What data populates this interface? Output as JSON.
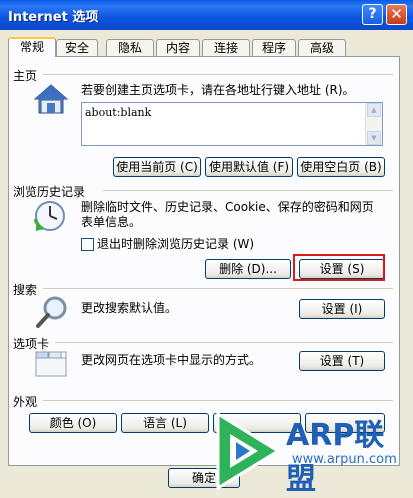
{
  "window": {
    "title": "Internet 选项",
    "help_glyph": "?",
    "close_glyph": "✕"
  },
  "tabs": [
    {
      "label": "常规",
      "active": true
    },
    {
      "label": "安全"
    },
    {
      "label": "隐私"
    },
    {
      "label": "内容"
    },
    {
      "label": "连接"
    },
    {
      "label": "程序"
    },
    {
      "label": "高级"
    }
  ],
  "home": {
    "section_label": "主页",
    "description": "若要创建主页选项卡，请在各地址行键入地址 (R)。",
    "address_value": "about:blank",
    "use_current": "使用当前页 (C)",
    "use_default": "使用默认值 (F)",
    "use_blank": "使用空白页 (B)"
  },
  "history": {
    "section_label": "浏览历史记录",
    "description_line1": "删除临时文件、历史记录、Cookie、保存的密码和网页",
    "description_line2": "表单信息。",
    "checkbox_label": "退出时删除浏览历史记录 (W)",
    "checkbox_checked": false,
    "delete_button": "删除 (D)...",
    "settings_button": "设置 (S)"
  },
  "search": {
    "section_label": "搜索",
    "description": "更改搜索默认值。",
    "settings_button": "设置 (I)"
  },
  "tabs_section": {
    "section_label": "选项卡",
    "description": "更改网页在选项卡中显示的方式。",
    "settings_button": "设置 (T)"
  },
  "appearance": {
    "section_label": "外观",
    "colors_button": "颜色 (O)",
    "languages_button": "语言 (L)"
  },
  "footer": {
    "ok_button": "确定"
  },
  "watermark": {
    "brand": "ARP联盟",
    "url": "www.arpun.com"
  },
  "colors": {
    "highlight": "#d81c1c",
    "title_blue": "#0a5ae8",
    "brand_blue": "#1f5fb6",
    "logo_green": "#2fb35a"
  }
}
